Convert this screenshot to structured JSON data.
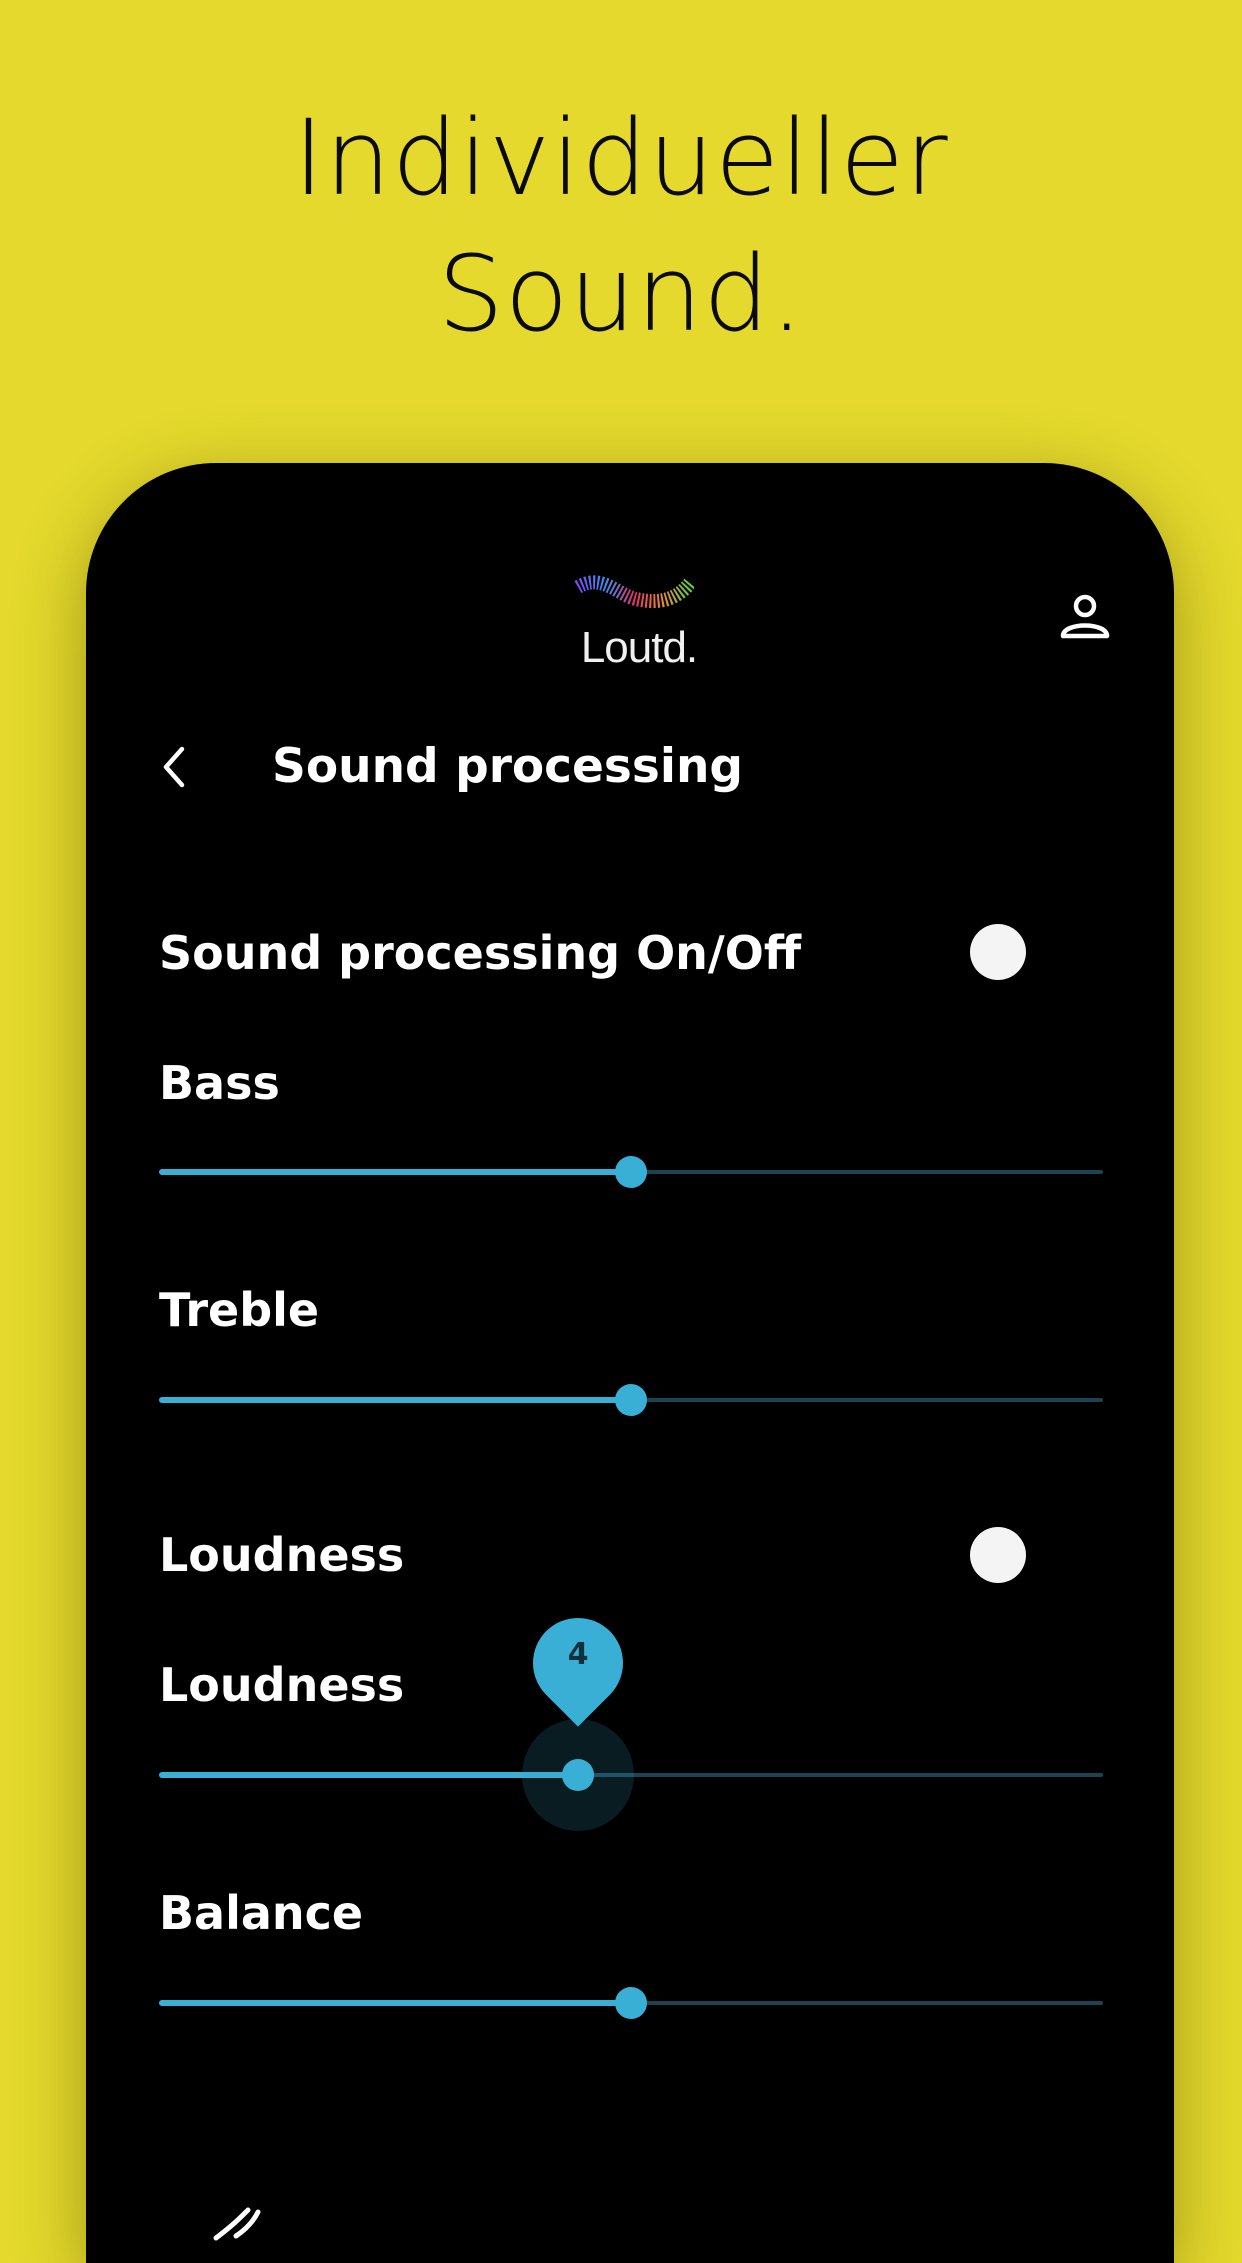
{
  "headline": {
    "line1": "Individueller",
    "line2": "Sound."
  },
  "app": {
    "logo_text": "Loutd."
  },
  "header": {
    "title": "Sound processing"
  },
  "settings": {
    "sound_processing": {
      "label": "Sound processing On/Off",
      "on": false
    },
    "bass": {
      "label": "Bass",
      "value_fraction": 0.5
    },
    "treble": {
      "label": "Treble",
      "value_fraction": 0.5
    },
    "loudness_toggle": {
      "label": "Loudness",
      "on": false
    },
    "loudness": {
      "label": "Loudness",
      "value": "4",
      "value_fraction": 0.444
    },
    "balance": {
      "label": "Balance",
      "value_fraction": 0.5
    }
  },
  "colors": {
    "background": "#e4d92c",
    "accent": "#3aafd6",
    "track_inactive": "#1d4353",
    "phone": "#000000",
    "text": "#ffffff"
  },
  "icons": [
    "back-chevron-icon",
    "profile-icon",
    "speaker-icon"
  ]
}
